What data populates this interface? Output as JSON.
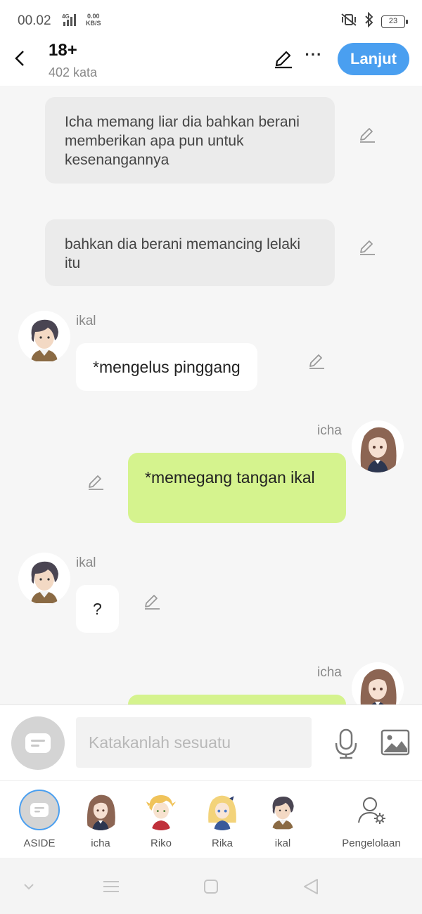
{
  "status": {
    "time": "00.02",
    "network": "4G",
    "speed_value": "0.00",
    "speed_unit": "KB/S",
    "battery": "23"
  },
  "header": {
    "title": "18+",
    "word_count": "402 kata",
    "next_label": "Lanjut"
  },
  "messages": [
    {
      "type": "narration",
      "text": "Icha memang liar dia bahkan berani memberikan apa pun untuk kesenangannya"
    },
    {
      "type": "narration",
      "text": "bahkan dia berani memancing lelaki itu"
    },
    {
      "type": "left",
      "name": "ikal",
      "text": "*mengelus pinggang"
    },
    {
      "type": "right",
      "name": "icha",
      "text": "*memegang tangan ikal"
    },
    {
      "type": "left",
      "name": "ikal",
      "text": "?"
    },
    {
      "type": "right",
      "name": "icha",
      "text": ""
    }
  ],
  "input": {
    "placeholder": "Katakanlah sesuatu"
  },
  "characters": [
    {
      "label": "ASIDE"
    },
    {
      "label": "icha"
    },
    {
      "label": "Riko"
    },
    {
      "label": "Rika"
    },
    {
      "label": "ikal"
    },
    {
      "label": "Pengelolaan"
    }
  ],
  "colors": {
    "accent": "#4a9ff0",
    "right_bubble": "#d5f38e",
    "narration_bubble": "#ebebeb",
    "chat_bg": "#f6f6f6"
  }
}
